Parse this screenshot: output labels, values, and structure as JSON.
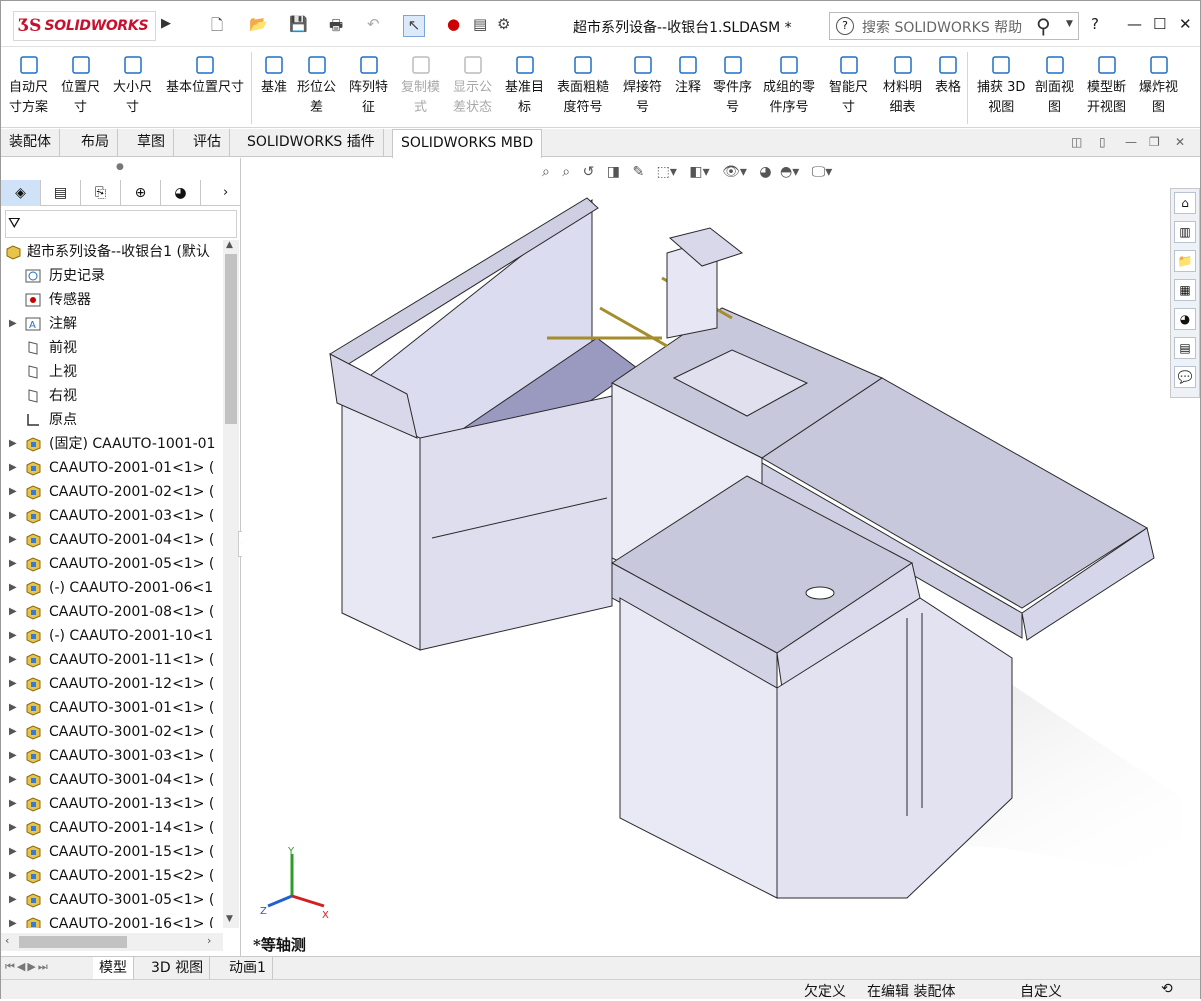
{
  "app": {
    "logo_text": "SOLIDWORKS",
    "doc_title": "超市系列设备--收银台1.SLDASM *",
    "search_placeholder": "搜索 SOLIDWORKS 帮助",
    "help_label": "?"
  },
  "ribbon": [
    {
      "l1": "自动尺",
      "l2": "寸方案",
      "icon": "auto-dimension-icon",
      "disabled": false
    },
    {
      "l1": "位置尺",
      "l2": "寸",
      "icon": "location-dimension-icon",
      "disabled": false
    },
    {
      "l1": "大小尺",
      "l2": "寸",
      "icon": "size-dimension-icon",
      "disabled": false
    },
    {
      "l1": "基本位置尺寸",
      "l2": "",
      "icon": "basic-location-dimension-icon",
      "disabled": false
    },
    {
      "l1": "基准",
      "l2": "",
      "icon": "datum-icon",
      "disabled": false
    },
    {
      "l1": "形位公",
      "l2": "差",
      "icon": "geometric-tolerance-icon",
      "disabled": false
    },
    {
      "l1": "阵列特",
      "l2": "征",
      "icon": "pattern-feature-icon",
      "disabled": false
    },
    {
      "l1": "复制模",
      "l2": "式",
      "icon": "copy-scheme-icon",
      "disabled": true
    },
    {
      "l1": "显示公",
      "l2": "差状态",
      "icon": "show-tolerance-status-icon",
      "disabled": true
    },
    {
      "l1": "基准目",
      "l2": "标",
      "icon": "datum-target-icon",
      "disabled": false
    },
    {
      "l1": "表面粗糙",
      "l2": "度符号",
      "icon": "surface-finish-icon",
      "disabled": false
    },
    {
      "l1": "焊接符",
      "l2": "号",
      "icon": "weld-symbol-icon",
      "disabled": false
    },
    {
      "l1": "注释",
      "l2": "",
      "icon": "note-icon",
      "disabled": false
    },
    {
      "l1": "零件序",
      "l2": "号",
      "icon": "balloon-icon",
      "disabled": false
    },
    {
      "l1": "成组的零",
      "l2": "件序号",
      "icon": "stacked-balloon-icon",
      "disabled": false
    },
    {
      "l1": "智能尺",
      "l2": "寸",
      "icon": "smart-dimension-icon",
      "disabled": false
    },
    {
      "l1": "材料明",
      "l2": "细表",
      "icon": "bom-icon",
      "disabled": false
    },
    {
      "l1": "表格",
      "l2": "",
      "icon": "table-icon",
      "disabled": false
    },
    {
      "l1": "捕获 3D",
      "l2": "视图",
      "icon": "capture-3d-view-icon",
      "disabled": false
    },
    {
      "l1": "剖面视",
      "l2": "图",
      "icon": "section-view-icon",
      "disabled": false
    },
    {
      "l1": "模型断",
      "l2": "开视图",
      "icon": "model-break-view-icon",
      "disabled": false
    },
    {
      "l1": "爆炸视",
      "l2": "图",
      "icon": "exploded-view-icon",
      "disabled": false
    }
  ],
  "command_tabs": [
    "装配体",
    "布局",
    "草图",
    "评估",
    "SOLIDWORKS 插件",
    "SOLIDWORKS MBD"
  ],
  "tree": {
    "root": "超市系列设备--收银台1  (默认",
    "items": [
      {
        "label": "历史记录",
        "exp": false,
        "type": "history"
      },
      {
        "label": "传感器",
        "exp": false,
        "type": "sensor"
      },
      {
        "label": "注解",
        "exp": true,
        "type": "annot"
      },
      {
        "label": "前视",
        "exp": false,
        "type": "plane"
      },
      {
        "label": "上视",
        "exp": false,
        "type": "plane"
      },
      {
        "label": "右视",
        "exp": false,
        "type": "plane"
      },
      {
        "label": "原点",
        "exp": false,
        "type": "origin"
      },
      {
        "label": "(固定) CAAUTO-1001-01",
        "exp": true,
        "type": "part"
      },
      {
        "label": "CAAUTO-2001-01<1> (",
        "exp": true,
        "type": "part"
      },
      {
        "label": "CAAUTO-2001-02<1> (",
        "exp": true,
        "type": "part"
      },
      {
        "label": "CAAUTO-2001-03<1> (",
        "exp": true,
        "type": "part"
      },
      {
        "label": "CAAUTO-2001-04<1> (",
        "exp": true,
        "type": "part"
      },
      {
        "label": "CAAUTO-2001-05<1> (",
        "exp": true,
        "type": "part"
      },
      {
        "label": "(-) CAAUTO-2001-06<1",
        "exp": true,
        "type": "part"
      },
      {
        "label": "CAAUTO-2001-08<1> (",
        "exp": true,
        "type": "part"
      },
      {
        "label": "(-) CAAUTO-2001-10<1",
        "exp": true,
        "type": "part"
      },
      {
        "label": "CAAUTO-2001-11<1> (",
        "exp": true,
        "type": "part"
      },
      {
        "label": "CAAUTO-2001-12<1> (",
        "exp": true,
        "type": "part"
      },
      {
        "label": "CAAUTO-3001-01<1> (",
        "exp": true,
        "type": "part"
      },
      {
        "label": "CAAUTO-3001-02<1> (",
        "exp": true,
        "type": "part"
      },
      {
        "label": "CAAUTO-3001-03<1> (",
        "exp": true,
        "type": "part"
      },
      {
        "label": "CAAUTO-3001-04<1> (",
        "exp": true,
        "type": "part"
      },
      {
        "label": "CAAUTO-2001-13<1> (",
        "exp": true,
        "type": "part"
      },
      {
        "label": "CAAUTO-2001-14<1> (",
        "exp": true,
        "type": "part"
      },
      {
        "label": "CAAUTO-2001-15<1> (",
        "exp": true,
        "type": "part"
      },
      {
        "label": "CAAUTO-2001-15<2> (",
        "exp": true,
        "type": "part"
      },
      {
        "label": "CAAUTO-3001-05<1> (",
        "exp": true,
        "type": "part"
      },
      {
        "label": "CAAUTO-2001-16<1> (",
        "exp": true,
        "type": "part"
      }
    ]
  },
  "viewport": {
    "view_label": "*等轴测",
    "triad": {
      "x": "X",
      "y": "Y",
      "z": "Z"
    }
  },
  "bottom_tabs": [
    "模型",
    "3D 视图",
    "动画1"
  ],
  "status": {
    "s1": "欠定义",
    "s2": "在编辑 装配体",
    "s3": "自定义"
  },
  "colors": {
    "brand": "#c8102e",
    "model_fill": "#e6e6f5",
    "model_shade": "#b9b9d6",
    "model_edge": "#2a2a2a",
    "accent_blue": "#1f6fc5"
  }
}
